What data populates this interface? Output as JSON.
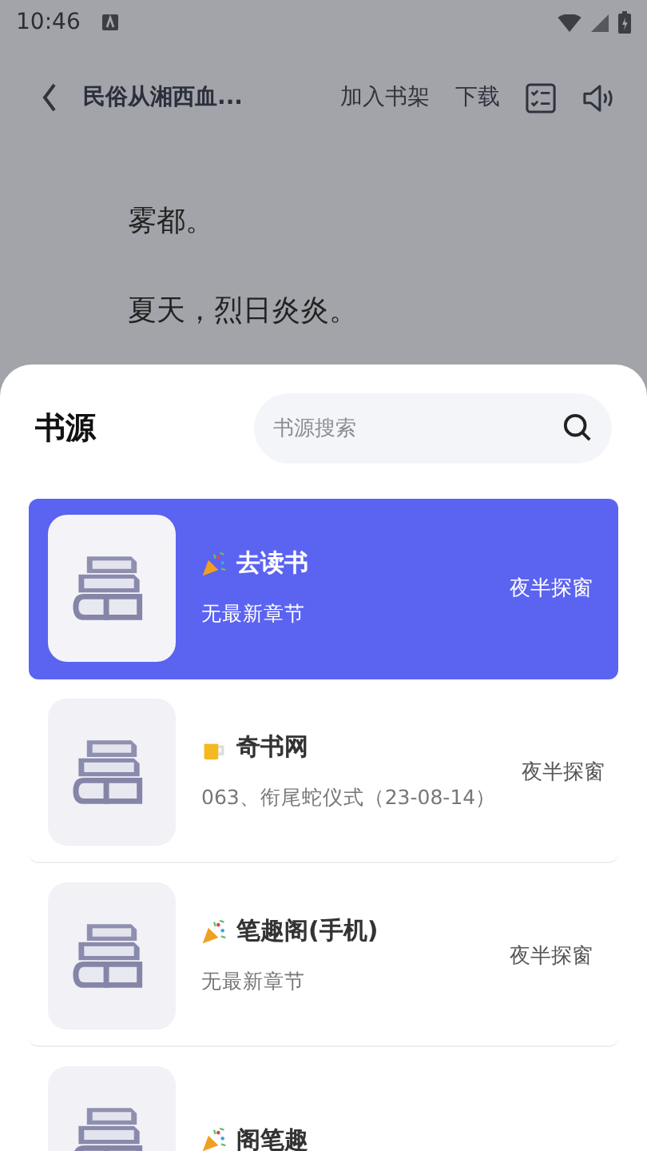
{
  "status_bar": {
    "time": "10:46"
  },
  "top_bar": {
    "title": "民俗从湘西血...",
    "actions": [
      "加入书架",
      "下载"
    ]
  },
  "reader": {
    "paragraphs": [
      "雾都。",
      "夏天，烈日炎炎。"
    ]
  },
  "sheet": {
    "title": "书源",
    "search": {
      "placeholder": "书源搜索"
    },
    "sources": [
      {
        "kind": "party",
        "name": "去读书",
        "latest": "无最新章节",
        "book": "夜半探窗",
        "selected": true
      },
      {
        "kind": "beer",
        "name": "奇书网",
        "latest": "063、衔尾蛇仪式（23-08-14）",
        "book": "夜半探窗",
        "selected": false
      },
      {
        "kind": "party",
        "name": "笔趣阁(手机)",
        "latest": "无最新章节",
        "book": "夜半探窗",
        "selected": false
      },
      {
        "kind": "party",
        "name": "阁笔趣",
        "selected": false
      }
    ]
  }
}
